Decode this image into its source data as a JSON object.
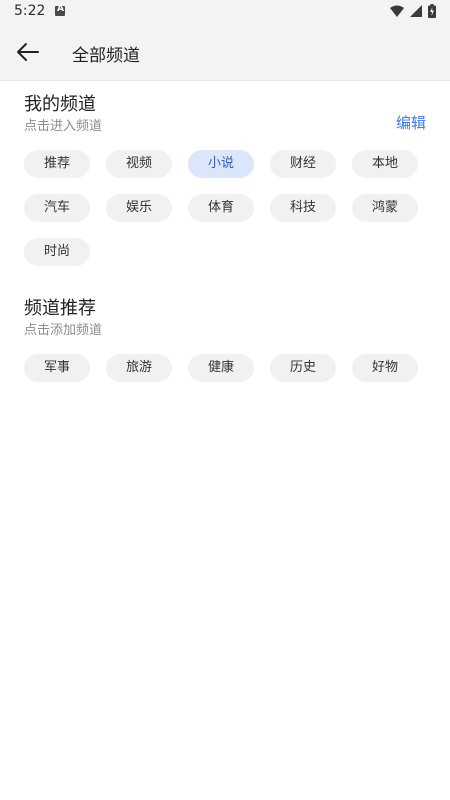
{
  "status": {
    "time": "5:22"
  },
  "header": {
    "title": "全部频道"
  },
  "my_channels": {
    "title": "我的频道",
    "subtitle": "点击进入频道",
    "edit_label": "编辑",
    "items": [
      {
        "label": "推荐"
      },
      {
        "label": "视频"
      },
      {
        "label": "小说"
      },
      {
        "label": "财经"
      },
      {
        "label": "本地"
      },
      {
        "label": "汽车"
      },
      {
        "label": "娱乐"
      },
      {
        "label": "体育"
      },
      {
        "label": "科技"
      },
      {
        "label": "鸿蒙"
      },
      {
        "label": "时尚"
      }
    ]
  },
  "recommended_channels": {
    "title": "频道推荐",
    "subtitle": "点击添加频道",
    "items": [
      {
        "label": "军事"
      },
      {
        "label": "旅游"
      },
      {
        "label": "健康"
      },
      {
        "label": "历史"
      },
      {
        "label": "好物"
      }
    ]
  },
  "colors": {
    "accent": "#3a7be0",
    "selected_chip_bg": "#dbe6fb",
    "chip_bg": "#f1f1f1"
  }
}
